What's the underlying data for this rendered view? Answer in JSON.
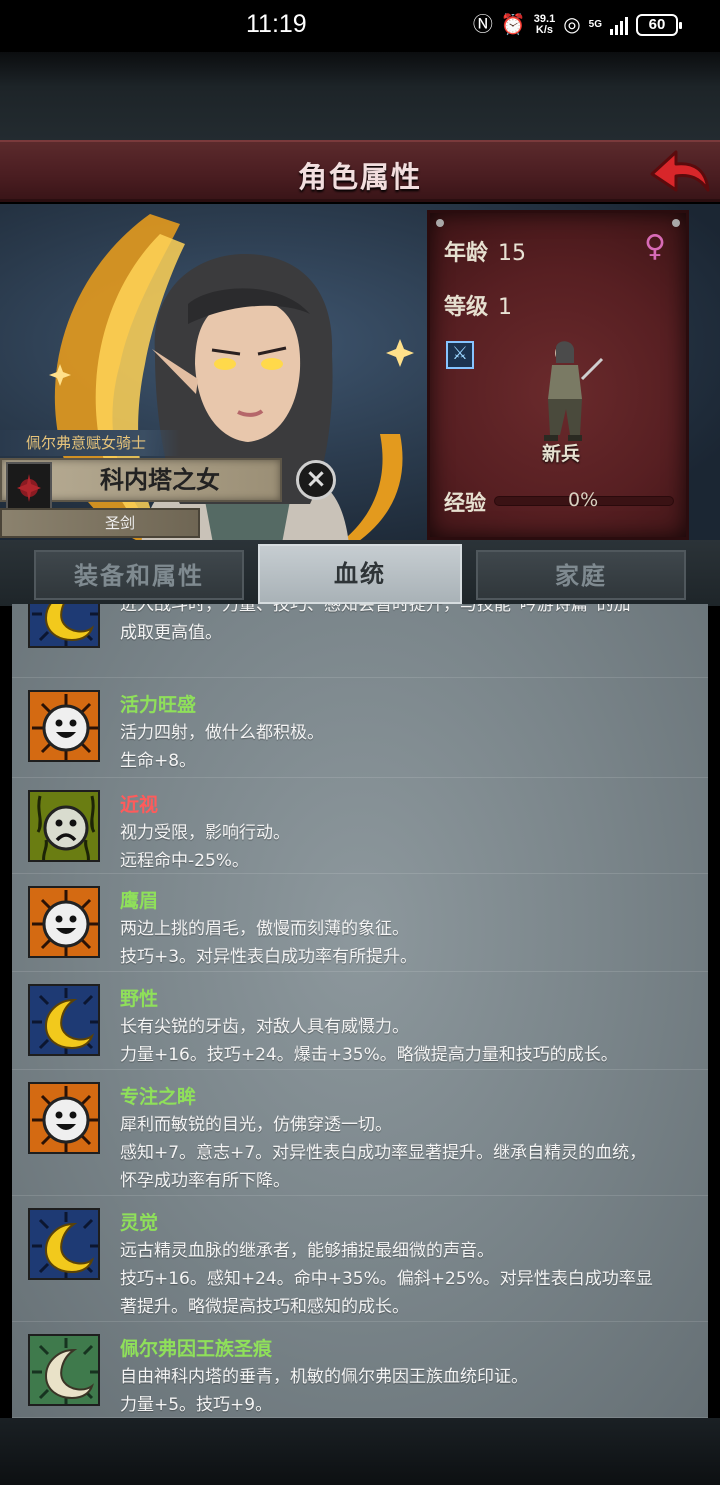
{
  "status_bar": {
    "time": "11:19",
    "net_speed_value": "39.1",
    "net_speed_unit": "K/s",
    "signal_label": "5G",
    "battery": "60"
  },
  "header": {
    "title": "角色属性"
  },
  "character": {
    "class_tag": "佩尔弗意赋女骑士",
    "name": "科内塔之女",
    "title": "圣剑",
    "age_label": "年龄",
    "age": "15",
    "level_label": "等级",
    "level": "1",
    "rank": "新兵",
    "exp_label": "经验",
    "exp_percent": "0%",
    "exp_fraction": 0
  },
  "tabs": [
    {
      "label": "装备和属性",
      "active": false
    },
    {
      "label": "血统",
      "active": true
    },
    {
      "label": "家庭",
      "active": false
    }
  ],
  "traits": [
    {
      "icon": "moon-icon",
      "name": "",
      "name_color": "#9be06a",
      "lines": [
        "进入战斗时，力量、技巧、感知会暂时提升，与技能“吟游诗篇”的加",
        "成取更高值。"
      ]
    },
    {
      "icon": "smile-icon",
      "name": "活力旺盛",
      "name_color": "#8fe05a",
      "lines": [
        "活力四射，做什么都积极。",
        "生命+8。"
      ]
    },
    {
      "icon": "frown-icon",
      "name": "近视",
      "name_color": "#ff5b5b",
      "lines": [
        "视力受限，影响行动。",
        "远程命中-25%。"
      ]
    },
    {
      "icon": "smile-icon",
      "name": "鹰眉",
      "name_color": "#8fe05a",
      "lines": [
        "两边上挑的眉毛，傲慢而刻薄的象征。",
        "技巧+3。对异性表白成功率有所提升。"
      ]
    },
    {
      "icon": "moon-icon",
      "name": "野性",
      "name_color": "#8fe05a",
      "lines": [
        "长有尖锐的牙齿，对敌人具有威慑力。",
        "力量+16。技巧+24。爆击+35%。略微提高力量和技巧的成长。"
      ]
    },
    {
      "icon": "smile-icon",
      "name": "专注之眸",
      "name_color": "#8fe05a",
      "lines": [
        "犀利而敏锐的目光，仿佛穿透一切。",
        "感知+7。意志+7。对异性表白成功率显著提升。继承自精灵的血统，",
        "怀孕成功率有所下降。"
      ]
    },
    {
      "icon": "moon-icon",
      "name": "灵觉",
      "name_color": "#8fe05a",
      "lines": [
        "远古精灵血脉的继承者，能够捕捉最细微的声音。",
        "技巧+16。感知+24。命中+35%。偏斜+25%。对异性表白成功率显",
        "著提升。略微提高技巧和感知的成长。"
      ]
    },
    {
      "icon": "holy-moon-icon",
      "name": "佩尔弗因王族圣痕",
      "name_color": "#8fe05a",
      "lines": [
        "自由神科内塔的垂青，机敏的佩尔弗因王族血统印证。",
        "力量+5。技巧+9。"
      ]
    }
  ],
  "colors": {
    "title_bar": "#4a1d21",
    "stats_panel": "#571f22",
    "good_trait": "#8fe05a",
    "bad_trait": "#ff5b5b",
    "gender": "#d86bb6"
  }
}
